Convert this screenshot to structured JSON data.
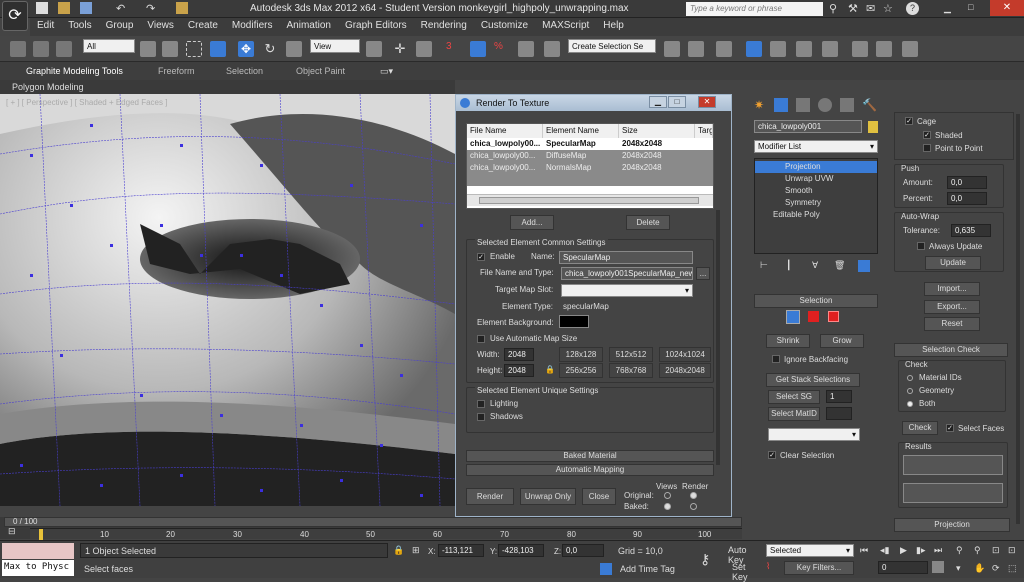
{
  "app": {
    "title": "Autodesk 3ds Max  2012 x64  - Student Version   monkeygirl_highpoly_unwrapping.max",
    "search_placeholder": "Type a keyword or phrase"
  },
  "menu": [
    "Edit",
    "Tools",
    "Group",
    "Views",
    "Create",
    "Modifiers",
    "Animation",
    "Graph Editors",
    "Rendering",
    "Customize",
    "MAXScript",
    "Help"
  ],
  "toolbar": {
    "selection_filter": "All",
    "ref_coord": "View",
    "named_selection": "Create Selection Se"
  },
  "ribbon": {
    "tabs": [
      "Graphite Modeling Tools",
      "Freeform",
      "Selection",
      "Object Paint"
    ],
    "panel": "Polygon Modeling"
  },
  "viewport": {
    "label": "[ + ] [ Perspective ] [ Shaded + Edged Faces ]"
  },
  "rtt": {
    "title": "Render To Texture",
    "columns": [
      "File Name",
      "Element Name",
      "Size",
      "Targ"
    ],
    "rows": [
      [
        "chica_lowpoly00...",
        "SpecularMap",
        "2048x2048"
      ],
      [
        "chica_lowpoly00...",
        "DiffuseMap",
        "2048x2048"
      ],
      [
        "chica_lowpoly00...",
        "NormalsMap",
        "2048x2048"
      ]
    ],
    "add": "Add...",
    "delete": "Delete",
    "common_title": "Selected Element Common Settings",
    "enable": "Enable",
    "name_label": "Name:",
    "name_value": "SpecularMap",
    "file_label": "File Name and Type:",
    "file_value": "chica_lowpoly001SpecularMap_new",
    "target_label": "Target Map Slot:",
    "type_label": "Element Type:",
    "type_value": "specularMap",
    "bg_label": "Element Background:",
    "auto_size": "Use Automatic Map Size",
    "width_label": "Width:",
    "width": "2048",
    "height_label": "Height:",
    "height": "2048",
    "sizes": [
      "128x128",
      "512x512",
      "1024x1024",
      "256x256",
      "768x768",
      "2048x2048"
    ],
    "unique_title": "Selected Element Unique Settings",
    "lighting": "Lighting",
    "shadows": "Shadows",
    "baked_material": "Baked Material",
    "auto_mapping": "Automatic Mapping",
    "render": "Render",
    "unwrap_only": "Unwrap Only",
    "close": "Close",
    "views": "Views",
    "render_col": "Render",
    "original": "Original:",
    "baked": "Baked:"
  },
  "cmd": {
    "object_name": "chica_lowpoly001",
    "modifier_list": "Modifier List",
    "stack": [
      "Projection",
      "Unwrap UVW",
      "Smooth",
      "Symmetry",
      "Editable Poly"
    ],
    "selection": "Selection",
    "shrink": "Shrink",
    "grow": "Grow",
    "ignore_backfacing": "Ignore Backfacing",
    "get_stack": "Get Stack Selections",
    "select_sg": "Select SG",
    "sg_val": "1",
    "select_matid": "Select MatID",
    "clear_selection": "Clear Selection",
    "cage": "Cage",
    "shaded": "Shaded",
    "point_to_point": "Point to Point",
    "push": "Push",
    "amount": "Amount:",
    "amount_val": "0,0",
    "percent": "Percent:",
    "percent_val": "0,0",
    "autowrap": "Auto-Wrap",
    "tolerance": "Tolerance:",
    "tolerance_val": "0,635",
    "always_update": "Always Update",
    "update": "Update",
    "import": "Import...",
    "export": "Export...",
    "reset": "Reset",
    "sel_check": "Selection Check",
    "check": "Check",
    "material_ids": "Material IDs",
    "geometry": "Geometry",
    "both": "Both",
    "check_btn": "Check",
    "select_faces": "Select Faces",
    "results": "Results",
    "projection": "Projection"
  },
  "time": {
    "frame": "0 / 100",
    "ticks": [
      "10",
      "20",
      "30",
      "40",
      "50",
      "60",
      "70",
      "80",
      "90",
      "100"
    ]
  },
  "status": {
    "script": "Max to Physc",
    "selected": "1 Object Selected",
    "prompt": "Select faces",
    "x": "-113,121",
    "y": "-428,103",
    "z": "0,0",
    "grid": "Grid = 10,0",
    "add_time_tag": "Add Time Tag",
    "auto_key": "Auto Key",
    "set_key": "Set Key",
    "key_mode": "Selected",
    "key_filters": "Key Filters...",
    "frame_field": "0"
  }
}
